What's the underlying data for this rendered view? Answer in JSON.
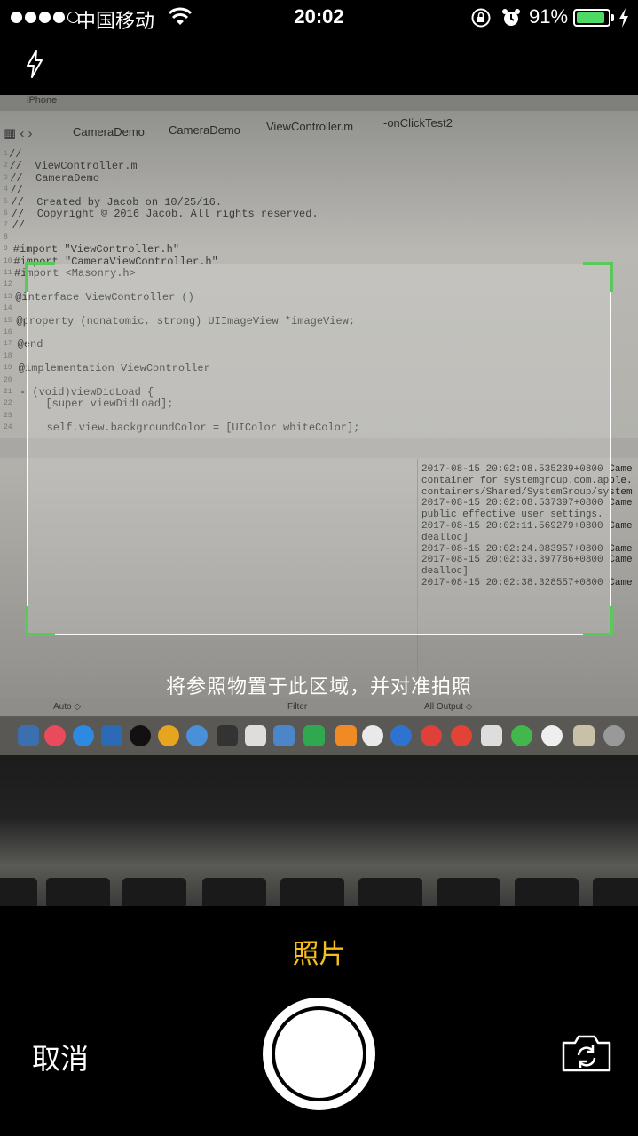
{
  "status_bar": {
    "carrier": "中国移动",
    "time": "20:02",
    "battery_percent": "91%",
    "battery_level": 0.91,
    "icons": [
      "signal-dots-icon",
      "wifi-icon",
      "rotation-lock-icon",
      "alarm-icon",
      "battery-icon",
      "charging-icon"
    ]
  },
  "camera": {
    "flash_icon": "flash-icon",
    "hint": "将参照物置于此区域，并对准拍照",
    "mode": "照片",
    "cancel_label": "取消",
    "shutter_icon": "shutter-button",
    "switch_icon": "switch-camera-icon",
    "accent_color": "#f5be1f",
    "corner_color": "#5bc85b"
  },
  "scene": {
    "tab": "iPhone",
    "breadcrumbs": [
      "CameraDemo",
      "CameraDemo",
      "ViewController.m",
      "-onClickTest2"
    ],
    "code": [
      "//",
      "//  ViewController.m",
      "//  CameraDemo",
      "//",
      "//  Created by Jacob on 10/25/16.",
      "//  Copyright © 2016 Jacob. All rights reserved.",
      "//",
      "",
      "#import \"ViewController.h\"",
      "#import \"CameraViewController.h\"",
      "#import <Masonry.h>",
      "",
      "@interface ViewController ()",
      "",
      "@property (nonatomic, strong) UIImageView *imageView;",
      "",
      "@end",
      "",
      "@implementation ViewController",
      "",
      "- (void)viewDidLoad {",
      "    [super viewDidLoad];",
      "",
      "    self.view.backgroundColor = [UIColor whiteColor];"
    ],
    "console": [
      "2017-08-15 20:02:08.535239+0800 Came",
      "container for systemgroup.com.apple.",
      "containers/Shared/SystemGroup/system",
      "2017-08-15 20:02:08.537397+0800 Came",
      "public effective user settings.",
      "2017-08-15 20:02:11.569279+0800 Came",
      "dealloc]",
      "2017-08-15 20:02:24.083957+0800 Came",
      "2017-08-15 20:02:33.397786+0800 Came",
      "dealloc]",
      "2017-08-15 20:02:38.328557+0800 Came"
    ],
    "bottom_bar": {
      "auto": "Auto ◇",
      "filter": "Filter",
      "output": "All Output ◇"
    }
  }
}
